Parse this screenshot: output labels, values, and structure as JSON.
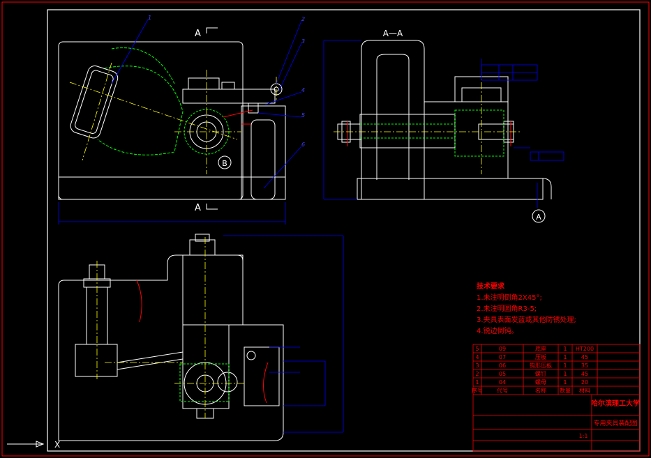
{
  "views": {
    "section_label_top": "A",
    "section_label_bottom": "A",
    "section_view_title": "A—A",
    "detail_label": "B",
    "datum_label": "A"
  },
  "callouts": {
    "leader_numbers": [
      "1",
      "2",
      "3",
      "4",
      "5",
      "6"
    ]
  },
  "tech_requirements": {
    "title": "技术要求",
    "items": [
      "1.未注明倒角2X45°;",
      "2.未注明圆角R3-5;",
      "3.夹具表面发蓝或其他防锈处理;",
      "4.锐边倒钝。"
    ]
  },
  "title_block": {
    "school": "哈尔滨理工大学",
    "drawing_title": "专用夹具装配图",
    "scale": "1:1",
    "header": [
      "序号",
      "代号",
      "名称",
      "数量",
      "材料"
    ],
    "rows": [
      [
        "5",
        "09",
        "底座",
        "1",
        "HT200"
      ],
      [
        "4",
        "07",
        "压板",
        "1",
        "45"
      ],
      [
        "3",
        "06",
        "钩形压板",
        "1",
        "35"
      ],
      [
        "2",
        "05",
        "螺钉",
        "1",
        "45"
      ],
      [
        "1",
        "04",
        "螺母",
        "1",
        "20"
      ],
      [
        "",
        "02",
        "夹具体",
        "1",
        "HT200"
      ]
    ]
  },
  "colors": {
    "background": "#000000",
    "frame": "#ff0000",
    "outline": "#ffffff",
    "dimension": "#0000ff",
    "centerline": "#ffff00",
    "hidden": "#00ff00",
    "text_red": "#ff0000",
    "datum_blue": "#4040ff"
  }
}
